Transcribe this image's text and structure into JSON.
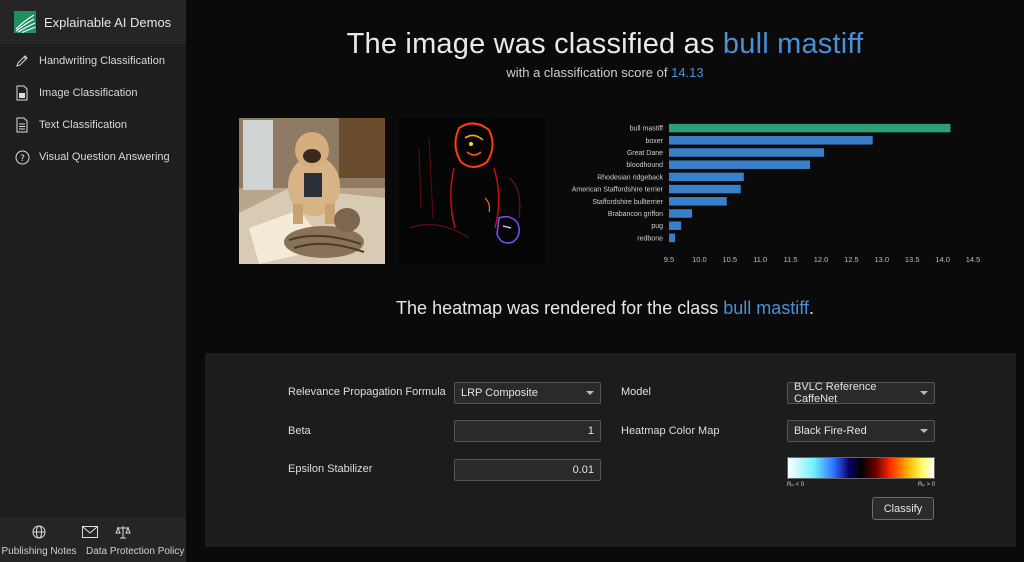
{
  "app": {
    "title": "Explainable AI Demos"
  },
  "sidebar": {
    "items": [
      {
        "label": "Handwriting Classification",
        "icon": "pencil-icon"
      },
      {
        "label": "Image Classification",
        "icon": "image-file-icon"
      },
      {
        "label": "Text Classification",
        "icon": "text-file-icon"
      },
      {
        "label": "Visual Question Answering",
        "icon": "question-circle-icon"
      }
    ],
    "footer": [
      {
        "label": "Publishing Notes",
        "icon": "globe-icon"
      },
      {
        "label": "Data Protection Policy",
        "icon": "envelope-icon"
      }
    ],
    "footer_extra_icon": "scales-icon"
  },
  "result": {
    "title_prefix": "The image was classified as ",
    "class_name": "bull mastiff",
    "subtitle_prefix": "with a classification score of ",
    "score": "14.13",
    "heatmap_caption_prefix": "The heatmap was rendered for the class ",
    "heatmap_class": "bull mastiff",
    "heatmap_caption_suffix": "."
  },
  "chart_data": {
    "type": "bar",
    "orientation": "horizontal",
    "categories": [
      "bull mastiff",
      "boxer",
      "Great Dane",
      "bloodhound",
      "Rhodesian ridgeback",
      "American Staffordshire terrier",
      "Staffordshire bullterrier",
      "Brabancon griffon",
      "pug",
      "redbone"
    ],
    "values": [
      14.13,
      12.85,
      12.05,
      11.82,
      10.73,
      10.68,
      10.45,
      9.88,
      9.7,
      9.6
    ],
    "highlight_index": 0,
    "xlim": [
      9.5,
      14.5
    ],
    "xticks": [
      "9.5",
      "10.0",
      "10.5",
      "11.0",
      "11.5",
      "12.0",
      "12.5",
      "13.0",
      "13.5",
      "14.0",
      "14.5"
    ],
    "colors": {
      "highlight": "#2e9e78",
      "bar": "#3a7fc9"
    },
    "grid": false
  },
  "controls": {
    "formula_label": "Relevance Propagation Formula",
    "formula_value": "LRP Composite",
    "beta_label": "Beta",
    "beta_value": "1",
    "epsilon_label": "Epsilon Stabilizer",
    "epsilon_value": "0.01",
    "model_label": "Model",
    "model_value": "BVLC Reference CaffeNet",
    "colormap_label": "Heatmap Color Map",
    "colormap_value": "Black Fire-Red",
    "colorbar_left": "Rₚ < 0",
    "colorbar_right": "Rₚ > 0",
    "classify_label": "Classify"
  },
  "colors": {
    "accent": "#4a90d9"
  }
}
